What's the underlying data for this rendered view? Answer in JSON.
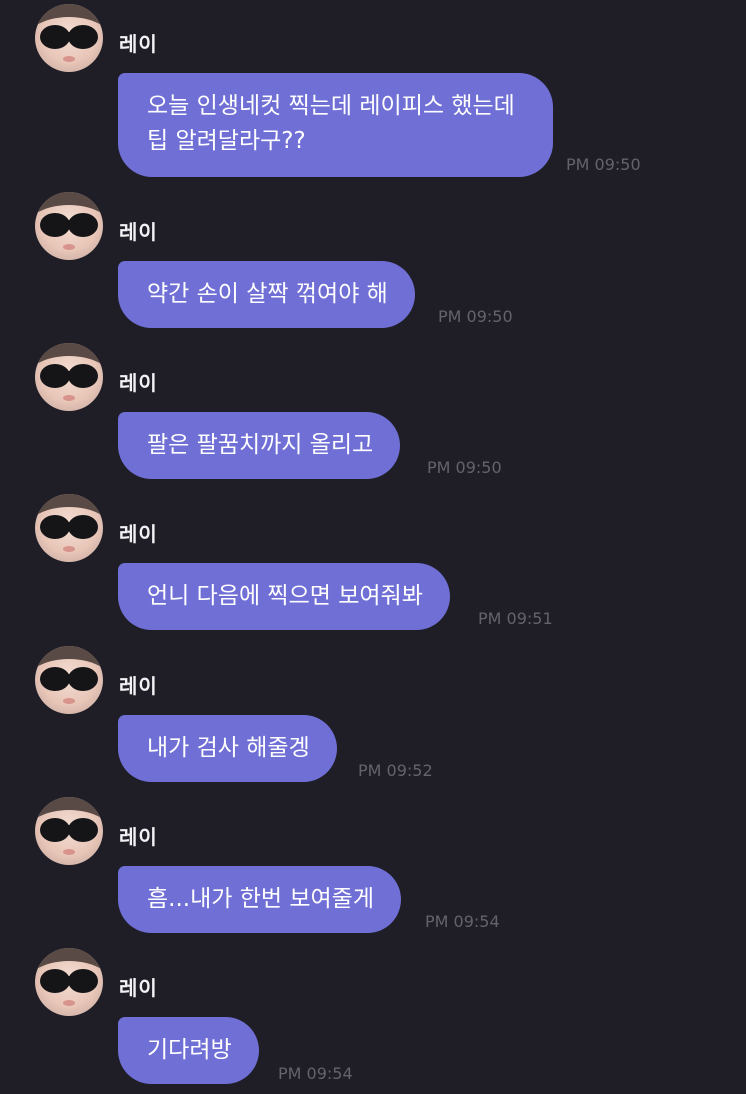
{
  "messages": [
    {
      "sender": "레이",
      "text": "오늘 인생네컷 찍는데 레이피스 했는데 팁 알려달라구??",
      "time": "PM 09:50"
    },
    {
      "sender": "레이",
      "text": "약간 손이 살짝 꺾여야 해",
      "time": "PM 09:50"
    },
    {
      "sender": "레이",
      "text": "팔은 팔꿈치까지 올리고",
      "time": "PM 09:50"
    },
    {
      "sender": "레이",
      "text": "언니 다음에 찍으면 보여줘봐",
      "time": "PM 09:51"
    },
    {
      "sender": "레이",
      "text": "내가 검사 해줄겡",
      "time": "PM 09:52"
    },
    {
      "sender": "레이",
      "text": "흠...내가 한번 보여줄게",
      "time": "PM 09:54"
    },
    {
      "sender": "레이",
      "text": "기다려방",
      "time": "PM 09:54"
    }
  ],
  "colors": {
    "background": "#1f1e27",
    "bubble": "#6f6fd6",
    "time": "#63636b",
    "sender": "#f2f2f5"
  },
  "icons": {
    "avatar": "profile-photo-sunglasses"
  }
}
